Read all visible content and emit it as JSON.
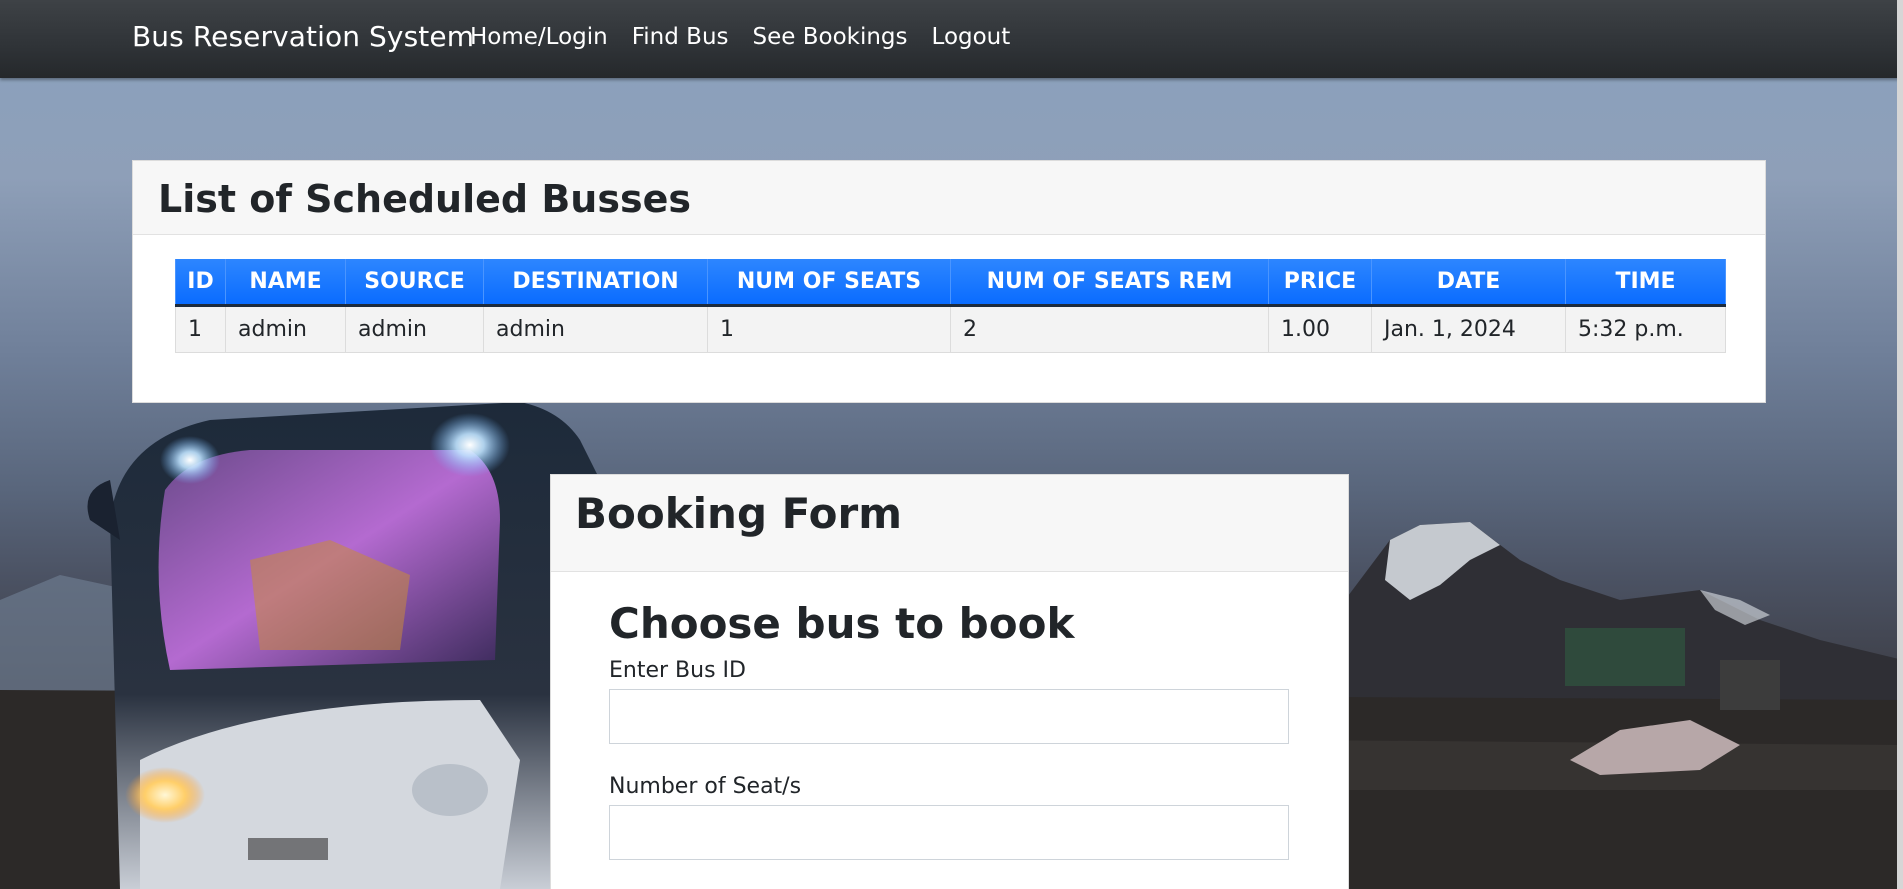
{
  "navbar": {
    "brand": "Bus Reservation System",
    "links": [
      "Home/Login",
      "Find Bus",
      "See Bookings",
      "Logout"
    ]
  },
  "bus_list": {
    "title": "List of Scheduled Busses",
    "columns": [
      "ID",
      "NAME",
      "SOURCE",
      "DESTINATION",
      "NUM OF SEATS",
      "NUM OF SEATS REM",
      "PRICE",
      "DATE",
      "TIME"
    ],
    "rows": [
      [
        "1",
        "admin",
        "admin",
        "admin",
        "1",
        "2",
        "1.00",
        "Jan. 1, 2024",
        "5:32 p.m."
      ]
    ]
  },
  "booking": {
    "title": "Booking Form",
    "subtitle": "Choose bus to book",
    "bus_id_label": "Enter Bus ID",
    "bus_id_value": "",
    "seats_label": "Number of Seat/s",
    "seats_value": ""
  },
  "colors": {
    "navbar": "#343a40",
    "table_header": "#0d6efd",
    "card_header": "#f7f7f7"
  }
}
